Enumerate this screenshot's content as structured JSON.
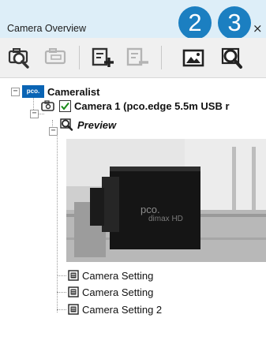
{
  "window": {
    "title": "Camera Overview",
    "close_glyph": "×"
  },
  "badges": [
    "2",
    "3"
  ],
  "toolbar": {
    "buttons": [
      {
        "icon": "camera-search-icon",
        "enabled": true
      },
      {
        "icon": "camera-disconnect-icon",
        "enabled": false
      },
      {
        "icon": "add-setting-icon",
        "enabled": true
      },
      {
        "icon": "remove-setting-icon",
        "enabled": false
      },
      {
        "icon": "image-icon",
        "enabled": true
      },
      {
        "icon": "preview-magnifier-icon",
        "enabled": true
      }
    ]
  },
  "tree": {
    "root": {
      "logo": "pco.",
      "label": "Cameralist"
    },
    "camera": {
      "label": "Camera 1 (pco.edge 5.5m USB r",
      "checked": true
    },
    "preview": {
      "label": "Preview"
    },
    "preview_image": {
      "brand": "pco.",
      "model": "dimax HD"
    },
    "settings": [
      "Camera Setting",
      "Camera Setting",
      "Camera Setting 2"
    ]
  },
  "colors": {
    "accent": "#1b7fc1",
    "titlebar": "#ddeef8",
    "toolbar": "#f0f0f0",
    "check": "#1a8a1a",
    "pco_logo": "#0a64b4"
  }
}
